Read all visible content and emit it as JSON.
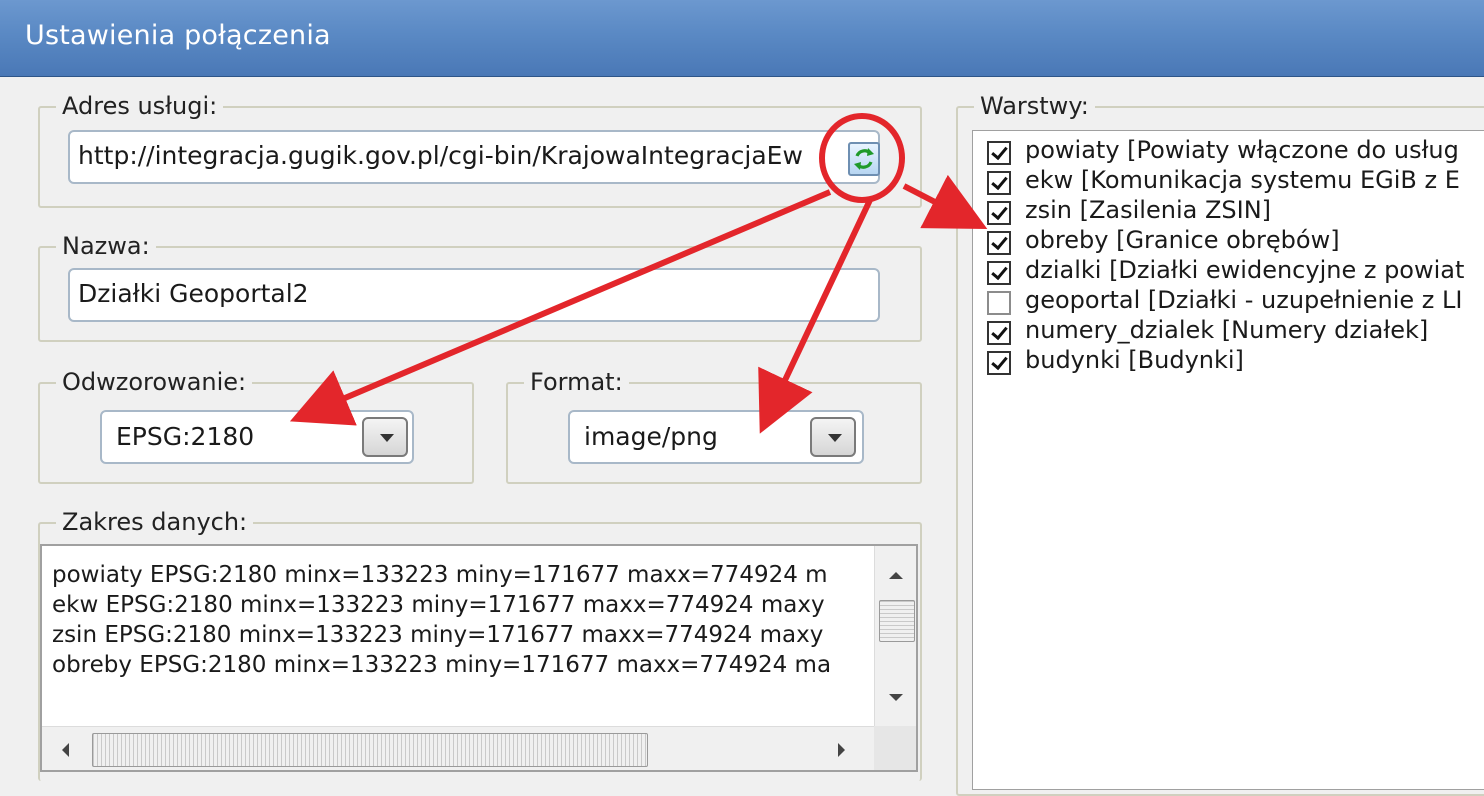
{
  "window": {
    "title": "Ustawienia połączenia"
  },
  "service_address": {
    "label": "Adres usługi:",
    "value": "http://integracja.gugik.gov.pl/cgi-bin/KrajowaIntegracjaEw",
    "refresh_icon": "refresh-icon"
  },
  "name": {
    "label": "Nazwa:",
    "value": "Działki Geoportal2"
  },
  "projection": {
    "label": "Odwzorowanie:",
    "selected": "EPSG:2180"
  },
  "format": {
    "label": "Format:",
    "selected": "image/png"
  },
  "extent": {
    "label": "Zakres danych:",
    "lines": [
      "powiaty EPSG:2180 minx=133223 miny=171677 maxx=774924 m",
      "ekw EPSG:2180 minx=133223 miny=171677 maxx=774924 maxy",
      "zsin EPSG:2180 minx=133223 miny=171677 maxx=774924 maxy",
      "obreby EPSG:2180 minx=133223 miny=171677 maxx=774924 ma"
    ]
  },
  "layers": {
    "label": "Warstwy:",
    "items": [
      {
        "label": "powiaty [Powiaty włączone do usług",
        "checked": true
      },
      {
        "label": "ekw [Komunikacja systemu EGiB z E",
        "checked": true
      },
      {
        "label": "zsin [Zasilenia ZSIN]",
        "checked": true
      },
      {
        "label": "obreby [Granice obrębów]",
        "checked": true
      },
      {
        "label": "dzialki [Działki ewidencyjne z powiat",
        "checked": true
      },
      {
        "label": "geoportal [Działki - uzupełnienie z LI",
        "checked": false
      },
      {
        "label": "numery_dzialek [Numery działek]",
        "checked": true
      },
      {
        "label": "budynki [Budynki]",
        "checked": true
      }
    ]
  },
  "colors": {
    "titlebar": "#5a89c4",
    "annotation": "#e3262b"
  }
}
